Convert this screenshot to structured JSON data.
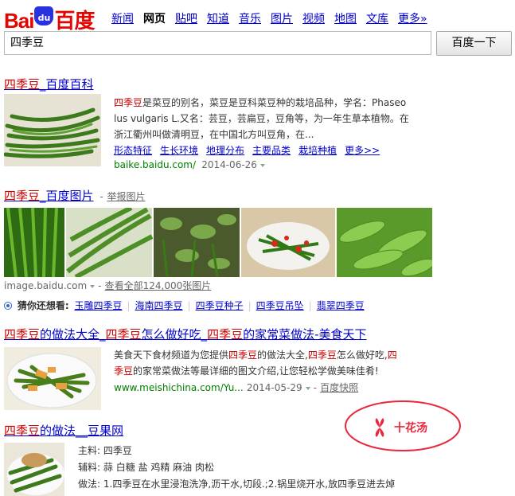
{
  "logo": {
    "part1": "Bai",
    "paw_text": "du",
    "part2": "百度"
  },
  "nav": [
    "新闻",
    "网页",
    "贴吧",
    "知道",
    "音乐",
    "图片",
    "视频",
    "地图",
    "文库",
    "更多»"
  ],
  "nav_current": "网页",
  "search": {
    "query": "四季豆",
    "button": "百度一下"
  },
  "result1": {
    "title_hl": "四季豆",
    "title_rest": "_百度百科",
    "desc_l1_hl": "四季豆",
    "desc_l1": "是菜豆的别名，菜豆是豆科菜豆种的栽培品种，学名：Phaseo",
    "desc_l2": "lus vulgaris L.又名：芸豆，芸扁豆，豆角等，为一年生草本植物。在",
    "desc_l3": "浙江衢州叫做清明豆，在中国北方叫豆角，在...",
    "links": [
      "形态特征",
      "生长环境",
      "地理分布",
      "主要品类",
      "栽培种植",
      "更多>>"
    ],
    "url": "baike.baidu.com/",
    "date": "2014-06-26"
  },
  "result2": {
    "title_hl": "四季豆",
    "title_rest": "_百度图片",
    "report": "举报图片",
    "url": "image.baidu.com",
    "view_all": "查看全部124,000张图片"
  },
  "related": {
    "label": "猜你还想看:",
    "items": [
      "玉雕四季豆",
      "海南四季豆",
      "四季豆种子",
      "四季豆吊坠",
      "翡翠四季豆"
    ]
  },
  "result3": {
    "title": [
      "四季豆",
      "的做法大全_",
      "四季豆",
      "怎么做好吃_",
      "四季豆",
      "的家常菜做法-美食天下"
    ],
    "desc_l1": [
      "美食天下食材频道为您提供",
      "四季豆",
      "的做法大全,",
      "四季豆",
      "怎么做好吃,",
      "四"
    ],
    "desc_l2": [
      "季豆",
      "的家常菜做法等最详细的图文介绍,让您轻松学做美味佳肴!"
    ],
    "url": "www.meishichina.com/Yu...",
    "date": "2014-05-29",
    "cache": "百度快照"
  },
  "result4": {
    "title_hl": "四季豆",
    "title_rest": "的做法__豆果网",
    "main_label": "主料:",
    "main": "四季豆",
    "aux_label": "辅料:",
    "aux": "蒜 白糖 盐 鸡精 麻油 肉松",
    "method_label": "做法:",
    "method": "1.四季豆在水里浸泡洗净,沥干水,切段.;2.锅里烧开水,放四季豆进去焯"
  },
  "watermark": "十花汤",
  "colors": {
    "accent": "#e10601",
    "link": "#0000cc",
    "highlight": "#cc0000",
    "url_green": "#008000",
    "watermark": "#e8283c"
  }
}
